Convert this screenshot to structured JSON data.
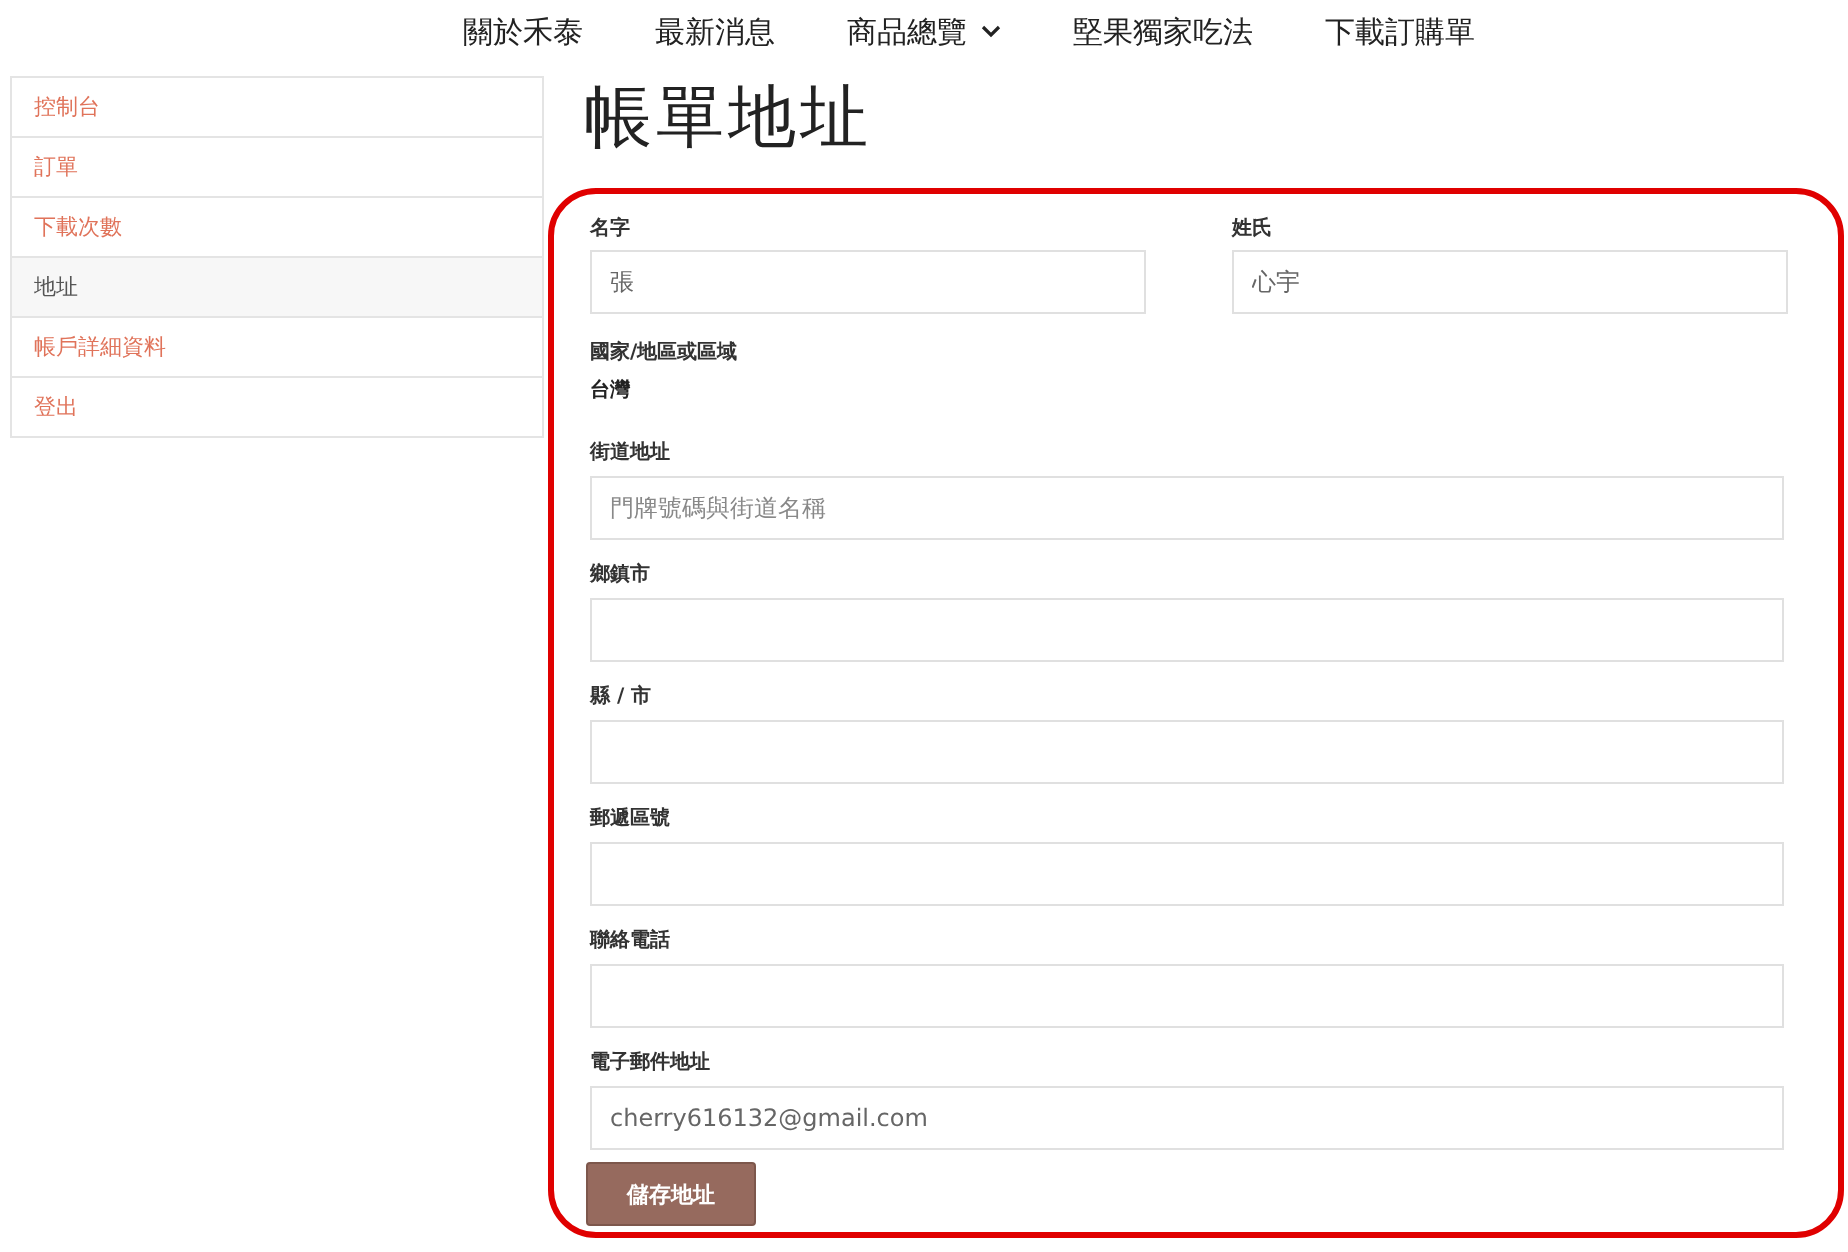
{
  "nav": [
    {
      "label": "關於禾泰",
      "dropdown": false
    },
    {
      "label": "最新消息",
      "dropdown": false
    },
    {
      "label": "商品總覽",
      "dropdown": true
    },
    {
      "label": "堅果獨家吃法",
      "dropdown": false
    },
    {
      "label": "下載訂購單",
      "dropdown": false
    }
  ],
  "sidebar": {
    "items": [
      {
        "label": "控制台",
        "selected": false
      },
      {
        "label": "訂單",
        "selected": false
      },
      {
        "label": "下載次數",
        "selected": false
      },
      {
        "label": "地址",
        "selected": true
      },
      {
        "label": "帳戶詳細資料",
        "selected": false
      },
      {
        "label": "登出",
        "selected": false
      }
    ]
  },
  "page_title": "帳單地址",
  "form": {
    "name_row": [
      {
        "label": "名字",
        "value": "張"
      },
      {
        "label": "姓氏",
        "value": "心宇"
      }
    ],
    "country": {
      "label": "國家/地區或區域",
      "value": "台灣"
    },
    "fields": [
      {
        "label": "街道地址",
        "placeholder": "門牌號碼與街道名稱"
      },
      {
        "label": "鄉鎮市"
      },
      {
        "label": "縣 / 市"
      },
      {
        "label": "郵遞區號"
      },
      {
        "label": "聯絡電話"
      },
      {
        "label": "電子郵件地址",
        "value": "cherry616132@gmail.com"
      }
    ],
    "submit": "儲存地址"
  }
}
